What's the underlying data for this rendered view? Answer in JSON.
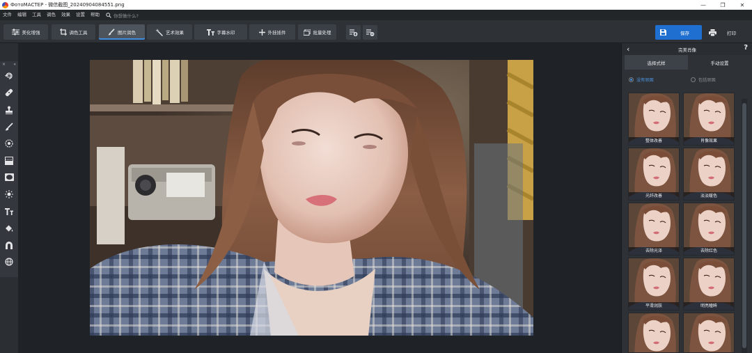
{
  "window": {
    "title": "ФотоМАСТЕР - 微信截图_20240904084551.png",
    "controls": [
      "—",
      "❐",
      "✕"
    ]
  },
  "menu": {
    "items": [
      "文件",
      "编辑",
      "工具",
      "调色",
      "效果",
      "设置",
      "帮助"
    ],
    "search_placeholder": "你想做什么?"
  },
  "toolbar": {
    "buttons": [
      {
        "label": "美化增强",
        "icon": "sliders-icon"
      },
      {
        "label": "调色工具",
        "icon": "crop-icon"
      },
      {
        "label": "图片润色",
        "icon": "brush-icon"
      },
      {
        "label": "艺术效果",
        "icon": "magic-wand-icon"
      },
      {
        "label": "字幕水印",
        "icon": "text-icon"
      },
      {
        "label": "外挂插件",
        "icon": "plus-icon"
      },
      {
        "label": "批量处理",
        "icon": "batch-icon"
      }
    ],
    "save_label": "保存",
    "print_label": "打印"
  },
  "left_tools": {
    "header": [
      "×",
      "«"
    ],
    "items": [
      "rotate-icon",
      "healing-icon",
      "stamp-icon",
      "brush-icon",
      "radial-filter-icon",
      "gradient-icon",
      "vignette-icon",
      "sun-icon",
      "text-icon",
      "fill-bucket-icon",
      "magnet-icon",
      "globe-icon"
    ]
  },
  "panel": {
    "title": "完美肖像",
    "tabs": [
      "选择式样",
      "手动设置"
    ],
    "active_tab": 0,
    "radio_options": [
      "没有顽固",
      "包括顽固"
    ],
    "selected_radio": 0,
    "presets": [
      "整体改善",
      "肖像效果",
      "光纤改善",
      "淡淡暖色",
      "去除光泽",
      "去除红色",
      "平滑润肤",
      "明亮瞳眸",
      "",
      ""
    ]
  },
  "colors": {
    "accent": "#1e6fd0",
    "toolbar_bg": "#2e3237",
    "canvas_bg": "#1f2226",
    "panel_bg": "#2e3237"
  }
}
